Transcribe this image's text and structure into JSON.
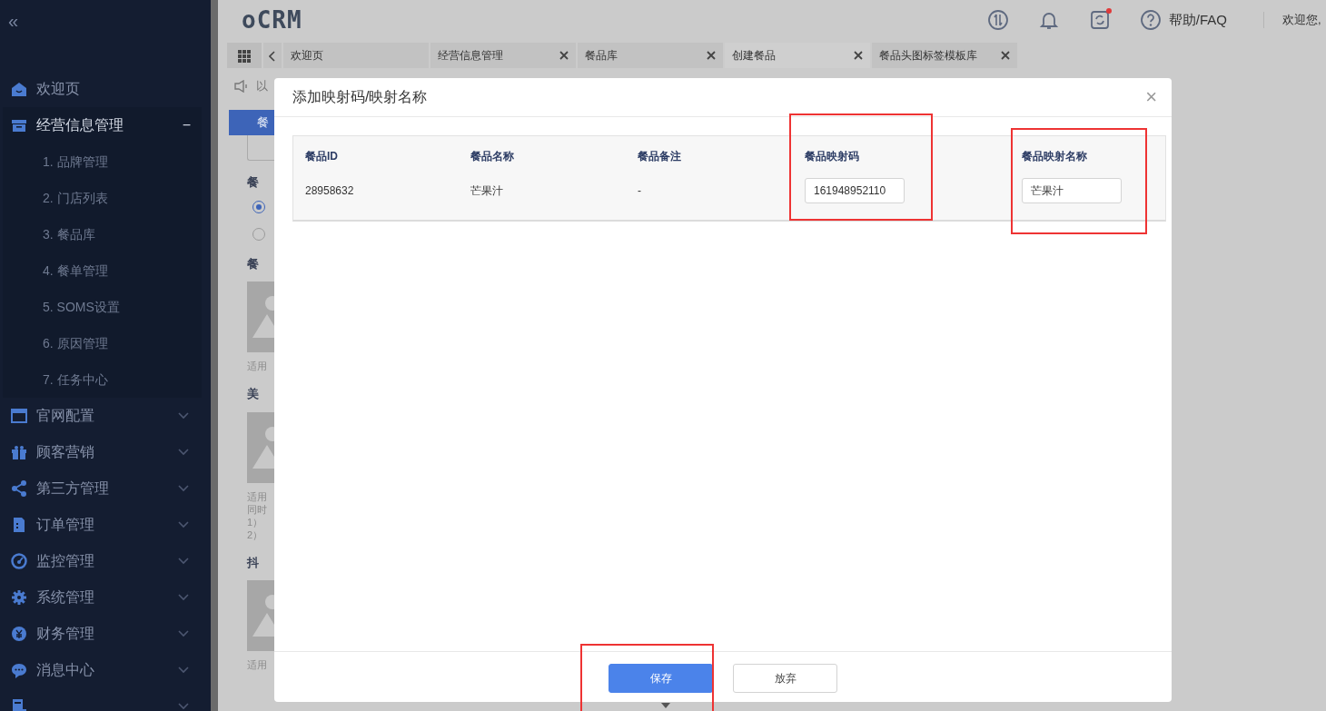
{
  "sidebar": {
    "collapse": "«",
    "items": [
      {
        "label": "欢迎页",
        "expanded": false
      },
      {
        "label": "经营信息管理",
        "expanded": true,
        "toggle": "−",
        "children": [
          {
            "label": "1. 品牌管理"
          },
          {
            "label": "2. 门店列表"
          },
          {
            "label": "3. 餐品库"
          },
          {
            "label": "4. 餐单管理"
          },
          {
            "label": "5. SOMS设置"
          },
          {
            "label": "6. 原因管理"
          },
          {
            "label": "7. 任务中心"
          }
        ]
      },
      {
        "label": "官网配置",
        "expanded": false
      },
      {
        "label": "顾客营销",
        "expanded": false
      },
      {
        "label": "第三方管理",
        "expanded": false
      },
      {
        "label": "订单管理",
        "expanded": false
      },
      {
        "label": "监控管理",
        "expanded": false
      },
      {
        "label": "系统管理",
        "expanded": false
      },
      {
        "label": "财务管理",
        "expanded": false
      },
      {
        "label": "消息中心",
        "expanded": false
      },
      {
        "expanded": false
      }
    ]
  },
  "header": {
    "logo": "oCRM",
    "notification_dot": true,
    "help": "帮助/FAQ",
    "welcome": "欢迎您,"
  },
  "tabs": [
    {
      "label": "欢迎页",
      "closable": false,
      "selected": false
    },
    {
      "label": "经营信息管理",
      "closable": true,
      "selected": false
    },
    {
      "label": "餐品库",
      "closable": true,
      "selected": false
    },
    {
      "label": "创建餐品",
      "closable": true,
      "selected": true
    },
    {
      "label": "餐品头图标签模板库",
      "closable": true,
      "selected": false
    }
  ],
  "background_page": {
    "notice": "以",
    "tab": "餐",
    "sections": [
      {
        "kind": "heading",
        "text": "餐"
      },
      {
        "kind": "radio",
        "checked": true
      },
      {
        "kind": "radio",
        "checked": false
      },
      {
        "kind": "heading",
        "text": "餐"
      },
      {
        "kind": "image"
      },
      {
        "kind": "caption",
        "lines": [
          "适用"
        ]
      },
      {
        "kind": "heading",
        "text": "美"
      },
      {
        "kind": "image"
      },
      {
        "kind": "caption",
        "lines": [
          "适用",
          "同时",
          "1）",
          "2）"
        ]
      },
      {
        "kind": "heading",
        "text": "抖"
      },
      {
        "kind": "image"
      },
      {
        "kind": "caption",
        "lines": [
          "适用"
        ]
      }
    ]
  },
  "dialog": {
    "title": "添加映射码/映射名称",
    "close": "×",
    "table": {
      "columns": [
        {
          "label": "餐品ID",
          "highlighted": false
        },
        {
          "label": "餐品名称",
          "highlighted": false
        },
        {
          "label": "餐品备注",
          "highlighted": false
        },
        {
          "label": "餐品映射码",
          "highlighted": true
        },
        {
          "label": "餐品映射名称",
          "highlighted": true
        }
      ],
      "rows": [
        [
          {
            "kind": "text",
            "value": "28958632"
          },
          {
            "kind": "text",
            "value": "芒果汁"
          },
          {
            "kind": "text",
            "value": "-"
          },
          {
            "kind": "input",
            "value": "161948952110"
          },
          {
            "kind": "input",
            "value": "芒果汁"
          }
        ]
      ]
    },
    "buttons": [
      {
        "label": "保存",
        "kind": "primary",
        "highlighted": true
      },
      {
        "label": "放弃",
        "kind": "secondary",
        "highlighted": false
      }
    ]
  }
}
